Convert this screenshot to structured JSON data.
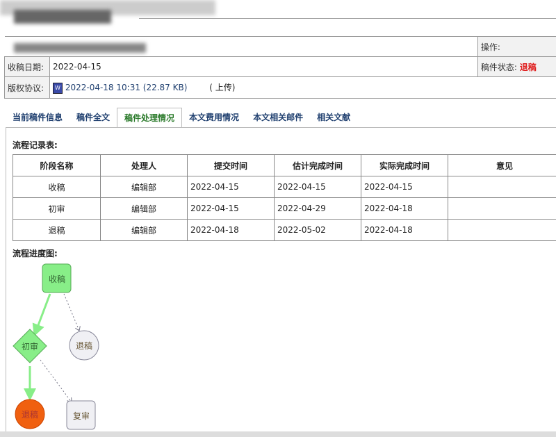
{
  "info": {
    "operation_label": "操作:",
    "received_label": "收稿日期:",
    "received_date": "2022-04-15",
    "status_label": "稿件状态:",
    "status_value": "退稿",
    "copyright_label": "版权协议:",
    "file_info": "2022-04-18 10:31 (22.87 KB)",
    "upload_link": "( 上传)"
  },
  "tabs": [
    "当前稿件信息",
    "稿件全文",
    "稿件处理情况",
    "本文费用情况",
    "本文相关邮件",
    "相关文献"
  ],
  "flow_table": {
    "title": "流程记录表:",
    "headers": [
      "阶段名称",
      "处理人",
      "提交时间",
      "估计完成时间",
      "实际完成时间",
      "意见"
    ],
    "rows": [
      [
        "收稿",
        "编辑部",
        "2022-04-15",
        "2022-04-15",
        "2022-04-15",
        ""
      ],
      [
        "初审",
        "编辑部",
        "2022-04-15",
        "2022-04-29",
        "2022-04-18",
        ""
      ],
      [
        "退稿",
        "编辑部",
        "2022-04-18",
        "2022-05-02",
        "2022-04-18",
        ""
      ]
    ]
  },
  "diagram": {
    "title": "流程进度图:",
    "nodes": [
      "收稿",
      "初审",
      "退稿",
      "退稿",
      "复审"
    ]
  },
  "colors": {
    "status": "#e02020",
    "done": "#88ee88",
    "current": "#f06010"
  }
}
